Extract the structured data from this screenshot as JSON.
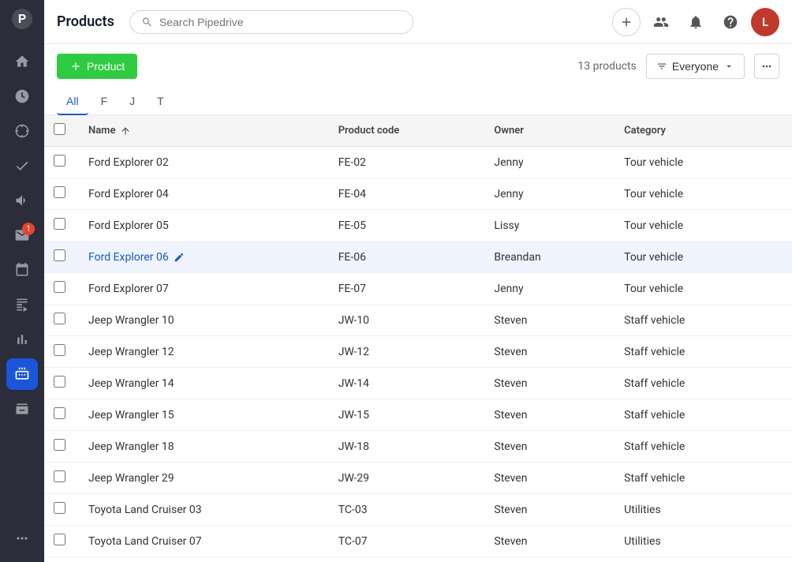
{
  "app": {
    "title": "Products"
  },
  "header": {
    "title": "Products",
    "search_placeholder": "Search Pipedrive"
  },
  "toolbar": {
    "add_button_label": "Product",
    "count_label": "13 products",
    "everyone_label": "Everyone",
    "more_icon": "⋯"
  },
  "filter_tabs": [
    {
      "label": "All",
      "active": true
    },
    {
      "label": "F",
      "active": false
    },
    {
      "label": "J",
      "active": false
    },
    {
      "label": "T",
      "active": false
    }
  ],
  "table": {
    "columns": [
      "Name",
      "Product code",
      "Owner",
      "Category"
    ],
    "rows": [
      {
        "name": "Ford Explorer 02",
        "code": "FE-02",
        "owner": "Jenny",
        "category": "Tour vehicle",
        "highlighted": false
      },
      {
        "name": "Ford Explorer 04",
        "code": "FE-04",
        "owner": "Jenny",
        "category": "Tour vehicle",
        "highlighted": false
      },
      {
        "name": "Ford Explorer 05",
        "code": "FE-05",
        "owner": "Lissy",
        "category": "Tour vehicle",
        "highlighted": false
      },
      {
        "name": "Ford Explorer 06",
        "code": "FE-06",
        "owner": "Breandan",
        "category": "Tour vehicle",
        "highlighted": true,
        "edit": true
      },
      {
        "name": "Ford Explorer 07",
        "code": "FE-07",
        "owner": "Jenny",
        "category": "Tour vehicle",
        "highlighted": false
      },
      {
        "name": "Jeep Wrangler 10",
        "code": "JW-10",
        "owner": "Steven",
        "category": "Staff vehicle",
        "highlighted": false
      },
      {
        "name": "Jeep Wrangler 12",
        "code": "JW-12",
        "owner": "Steven",
        "category": "Staff vehicle",
        "highlighted": false
      },
      {
        "name": "Jeep Wrangler 14",
        "code": "JW-14",
        "owner": "Steven",
        "category": "Staff vehicle",
        "highlighted": false
      },
      {
        "name": "Jeep Wrangler 15",
        "code": "JW-15",
        "owner": "Steven",
        "category": "Staff vehicle",
        "highlighted": false
      },
      {
        "name": "Jeep Wrangler 18",
        "code": "JW-18",
        "owner": "Steven",
        "category": "Staff vehicle",
        "highlighted": false
      },
      {
        "name": "Jeep Wrangler 29",
        "code": "JW-29",
        "owner": "Steven",
        "category": "Staff vehicle",
        "highlighted": false
      },
      {
        "name": "Toyota Land Cruiser 03",
        "code": "TC-03",
        "owner": "Steven",
        "category": "Utilities",
        "highlighted": false
      },
      {
        "name": "Toyota Land Cruiser 07",
        "code": "TC-07",
        "owner": "Steven",
        "category": "Utilities",
        "highlighted": false
      }
    ]
  },
  "sidebar": {
    "items": [
      {
        "icon": "🏠",
        "name": "home",
        "active": false
      },
      {
        "icon": "⬤",
        "name": "activity",
        "active": false
      },
      {
        "icon": "$",
        "name": "deals",
        "active": false
      },
      {
        "icon": "☑",
        "name": "leads",
        "active": false
      },
      {
        "icon": "📣",
        "name": "campaigns",
        "active": false
      },
      {
        "icon": "✉",
        "name": "mail",
        "active": false,
        "badge": "1"
      },
      {
        "icon": "📅",
        "name": "calendar",
        "active": false
      },
      {
        "icon": "📋",
        "name": "contacts",
        "active": false
      },
      {
        "icon": "📈",
        "name": "reports",
        "active": false
      },
      {
        "icon": "📦",
        "name": "products",
        "active": true
      },
      {
        "icon": "🏪",
        "name": "marketplace",
        "active": false
      }
    ],
    "bottom": [
      {
        "icon": "⋯",
        "name": "more"
      }
    ]
  },
  "colors": {
    "sidebar_bg": "#2c2d3a",
    "active_blue": "#1a56db",
    "add_green": "#2ecc40",
    "highlight_row": "#eff4ff"
  }
}
